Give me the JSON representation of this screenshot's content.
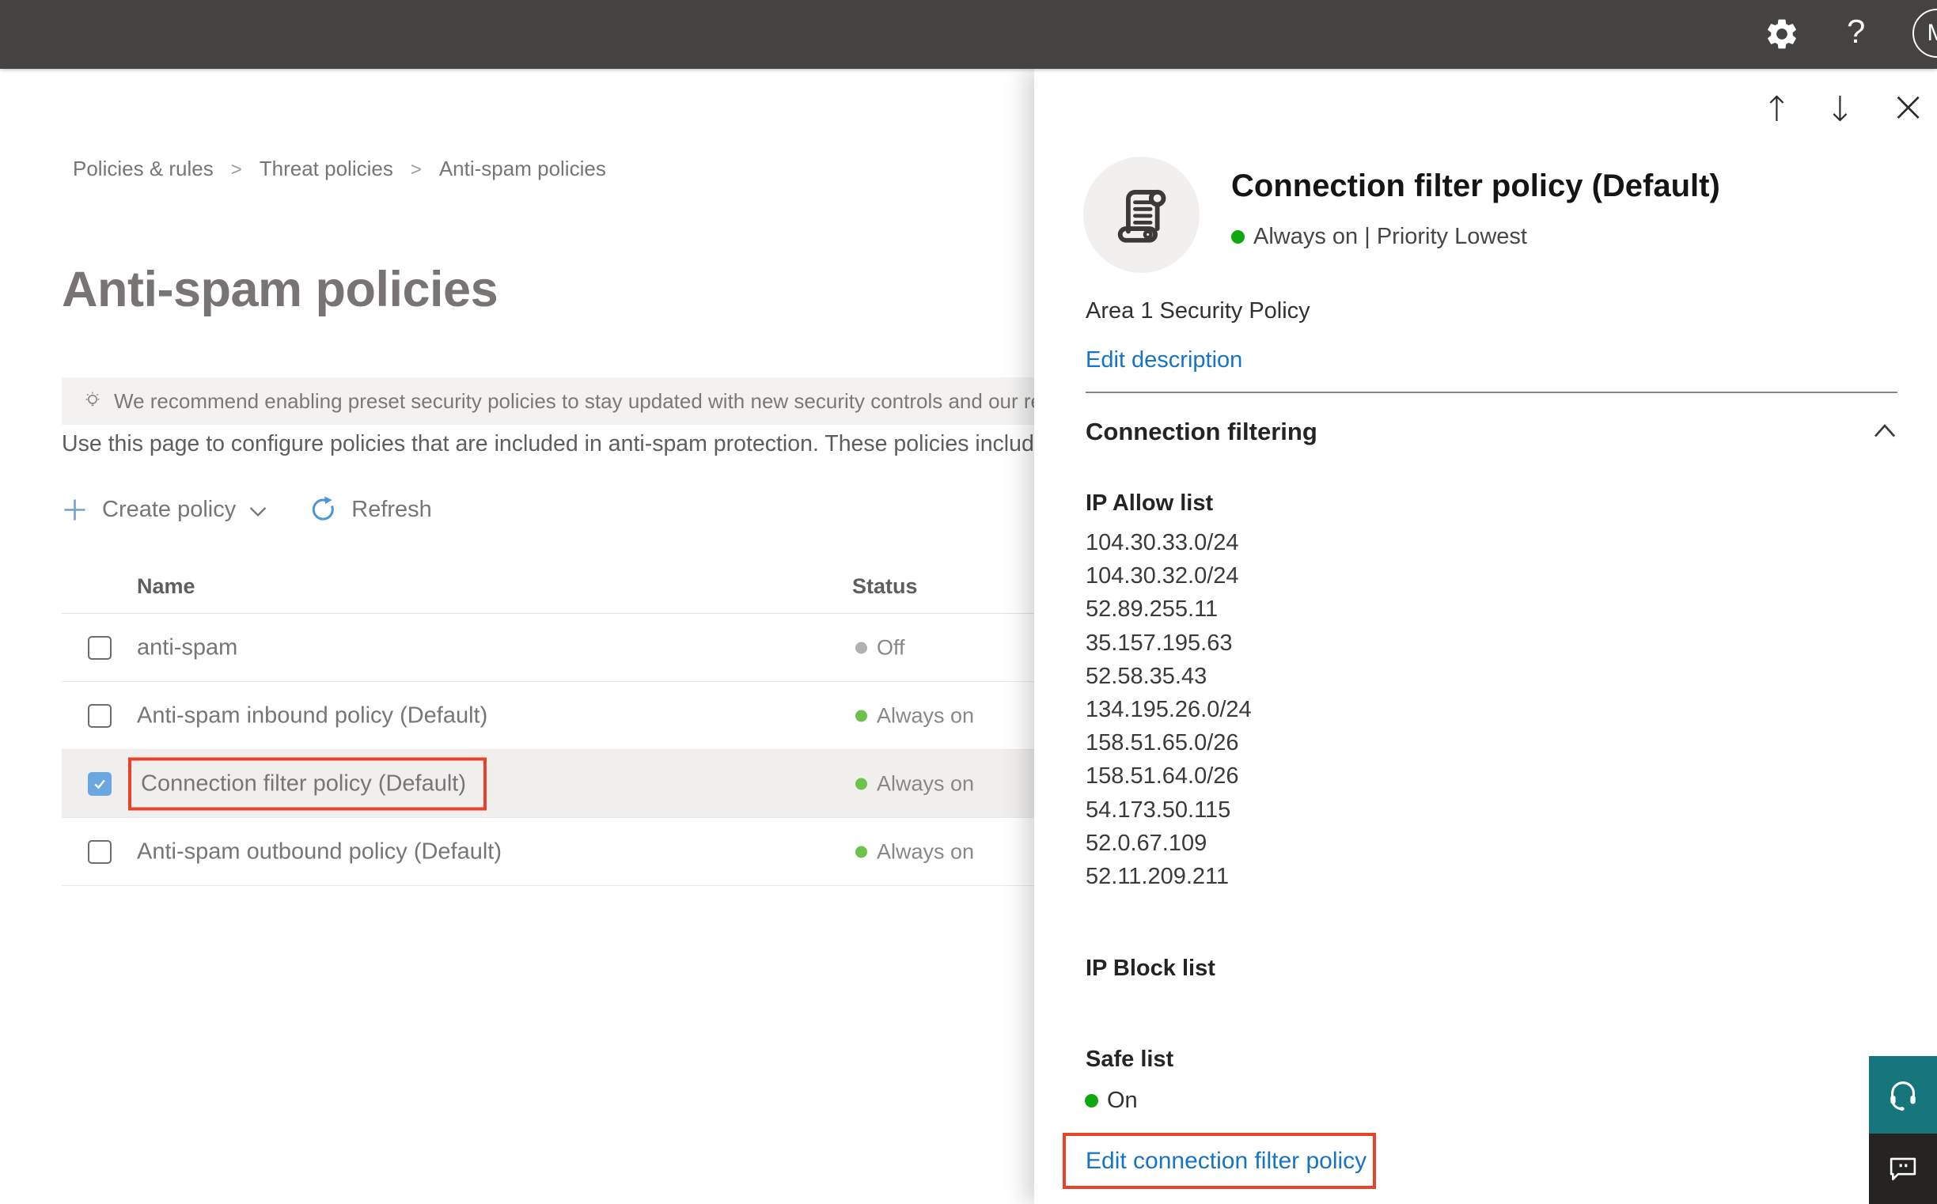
{
  "topbar": {
    "help_label": "?",
    "avatar_initial": "M"
  },
  "icons": {
    "arrow_up": "↑",
    "arrow_down": "↓",
    "close": "×"
  },
  "breadcrumb": {
    "separator": ">",
    "items": [
      "Policies & rules",
      "Threat policies",
      "Anti-spam policies"
    ]
  },
  "page": {
    "title": "Anti-spam policies",
    "banner_text": "We recommend enabling preset security policies to stay updated with new security controls and our recomme",
    "intro_text": "Use this page to configure policies that are included in anti-spam protection. These policies include"
  },
  "toolbar": {
    "create_label": "Create policy",
    "refresh_label": "Refresh"
  },
  "table": {
    "columns": {
      "name": "Name",
      "status": "Status"
    },
    "rows": [
      {
        "name": "anti-spam",
        "status": "Off",
        "state": "off",
        "checked": false,
        "selected": false
      },
      {
        "name": "Anti-spam inbound policy (Default)",
        "status": "Always on",
        "state": "on",
        "checked": false,
        "selected": false
      },
      {
        "name": "Connection filter policy (Default)",
        "status": "Always on",
        "state": "on",
        "checked": true,
        "selected": true,
        "highlighted": true
      },
      {
        "name": "Anti-spam outbound policy (Default)",
        "status": "Always on",
        "state": "on",
        "checked": false,
        "selected": false
      }
    ]
  },
  "flyout": {
    "title": "Connection filter policy (Default)",
    "status_text": "Always on | Priority Lowest",
    "description": "Area 1 Security Policy",
    "edit_description_label": "Edit description",
    "section_title": "Connection filtering",
    "ip_allow_title": "IP Allow list",
    "ip_allow_list": [
      "104.30.33.0/24",
      "104.30.32.0/24",
      "52.89.255.11",
      "35.157.195.63",
      "52.58.35.43",
      "134.195.26.0/24",
      "158.51.65.0/26",
      "158.51.64.0/26",
      "54.173.50.115",
      "52.0.67.109",
      "52.11.209.211"
    ],
    "ip_block_title": "IP Block list",
    "safe_list_title": "Safe list",
    "safe_list_status": "On",
    "edit_link_label": "Edit connection filter policy"
  },
  "colors": {
    "topbar_bg": "#454341",
    "accent_link_blue": "#1673c5",
    "toolbar_icon_blue": "#76a0ce",
    "status_green_table": "#6cc24a",
    "status_green_flyout": "#10a80e",
    "status_gray": "#b3b1af",
    "highlight_red": "#e8432a",
    "checkbox_blue": "#6aa7e0",
    "support_teal": "#17767c",
    "feedback_dark": "#252423"
  }
}
